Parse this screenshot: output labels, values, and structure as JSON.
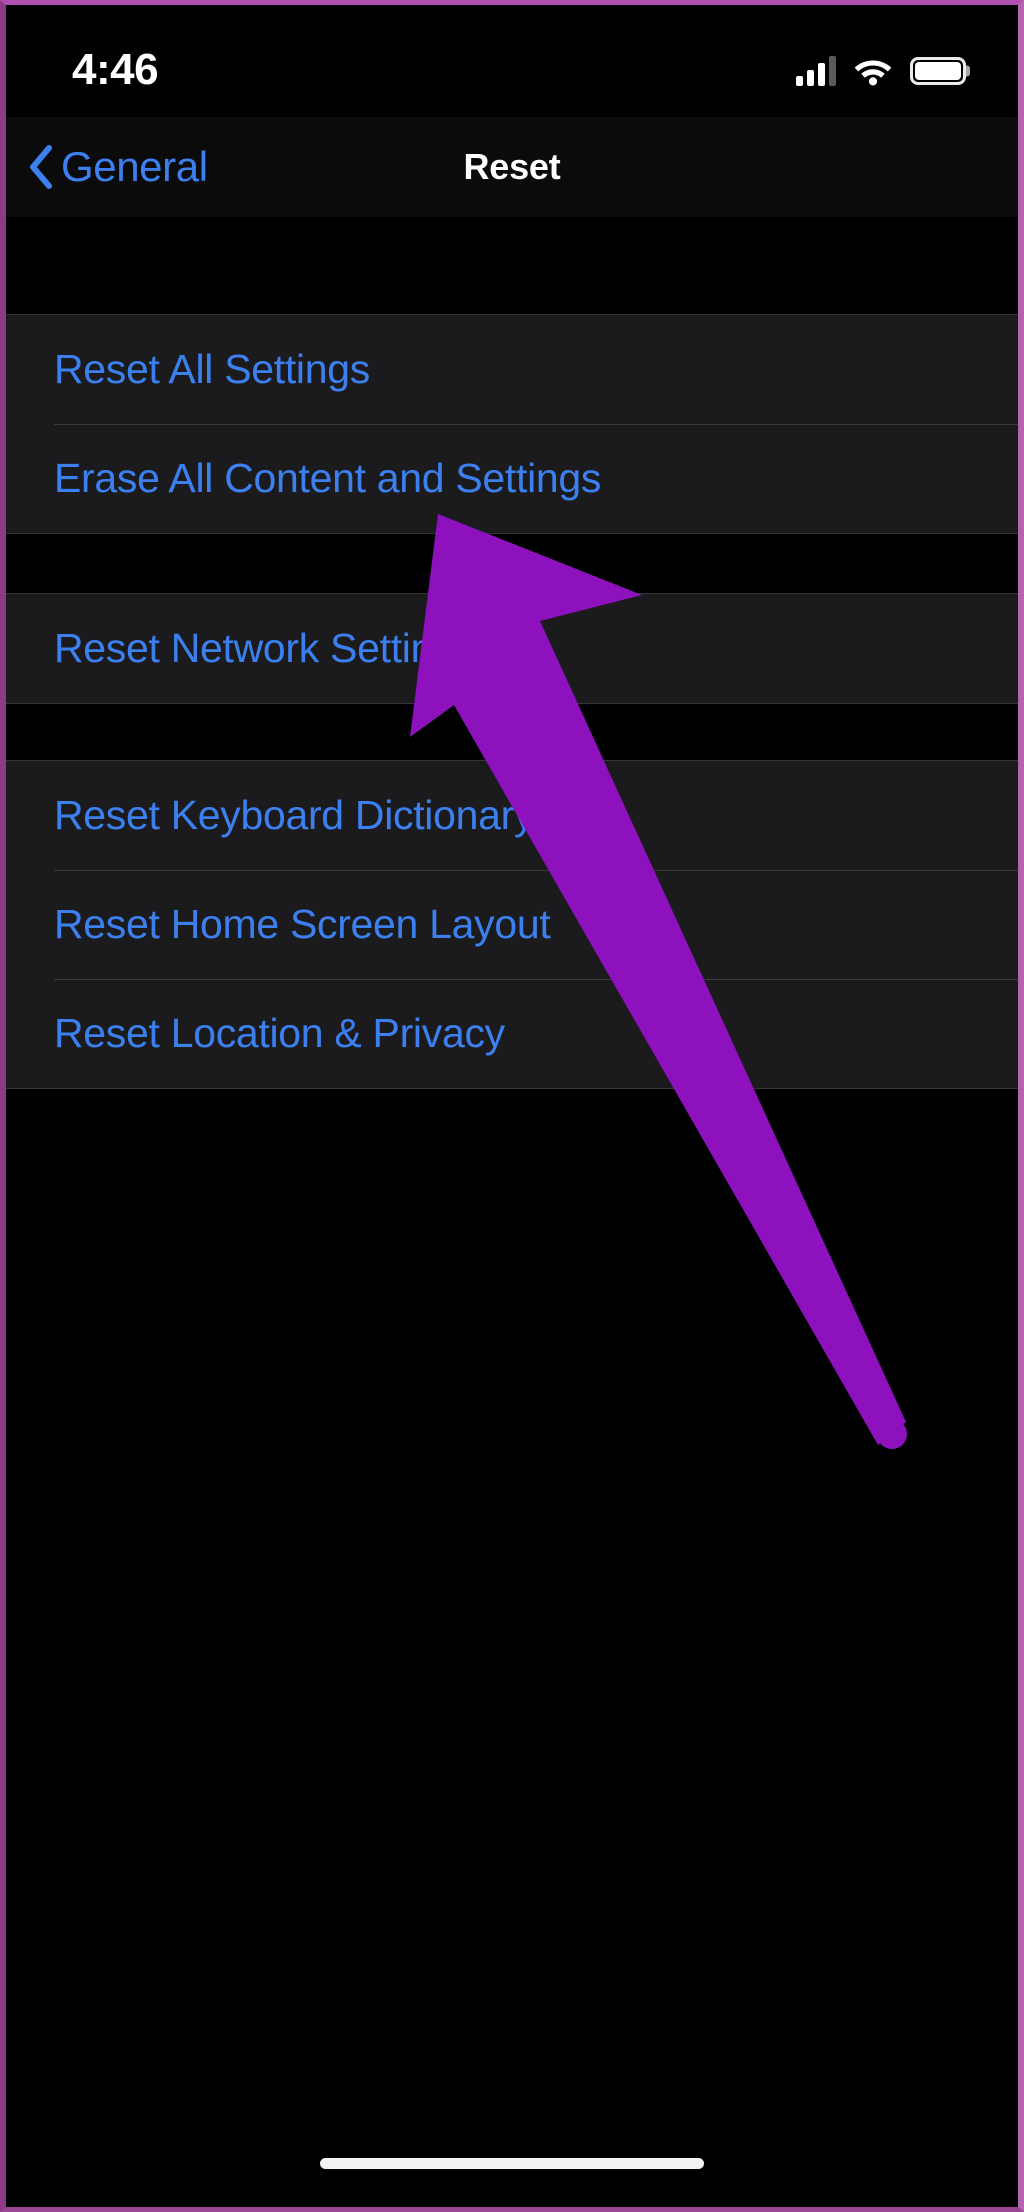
{
  "status_bar": {
    "time": "4:46",
    "cellular_icon": "cellular-signal-icon",
    "cellular_bars_filled": 3,
    "cellular_bars_total": 4,
    "wifi_icon": "wifi-icon",
    "battery_icon": "battery-icon",
    "battery_level_percent": 100
  },
  "nav_bar": {
    "back_icon": "chevron-left-icon",
    "back_label": "General",
    "title": "Reset"
  },
  "groups": [
    {
      "name": "reset-settings-group",
      "rows": [
        {
          "label": "Reset All Settings",
          "name": "row-reset-all-settings"
        },
        {
          "label": "Erase All Content and Settings",
          "name": "row-erase-all-content-and-settings"
        }
      ]
    },
    {
      "name": "network-group",
      "rows": [
        {
          "label": "Reset Network Settings",
          "name": "row-reset-network-settings"
        }
      ]
    },
    {
      "name": "misc-reset-group",
      "rows": [
        {
          "label": "Reset Keyboard Dictionary",
          "name": "row-reset-keyboard-dictionary"
        },
        {
          "label": "Reset Home Screen Layout",
          "name": "row-reset-home-screen-layout"
        },
        {
          "label": "Reset Location & Privacy",
          "name": "row-reset-location-and-privacy"
        }
      ]
    }
  ],
  "annotation": {
    "type": "arrow",
    "name": "annotation-arrow",
    "points_to": "Reset Network Settings",
    "color": "#8E11BE"
  },
  "home_indicator": {
    "name": "home-indicator",
    "color": "#F2F2F2"
  },
  "colors": {
    "accent_blue": "#3C80F0",
    "row_background": "#1B1B1D",
    "page_background": "#000000",
    "separator": "#39393C",
    "annotation_purple": "#8E11BE",
    "frame_left": "#8E3A84",
    "frame_right": "#B565B0"
  }
}
